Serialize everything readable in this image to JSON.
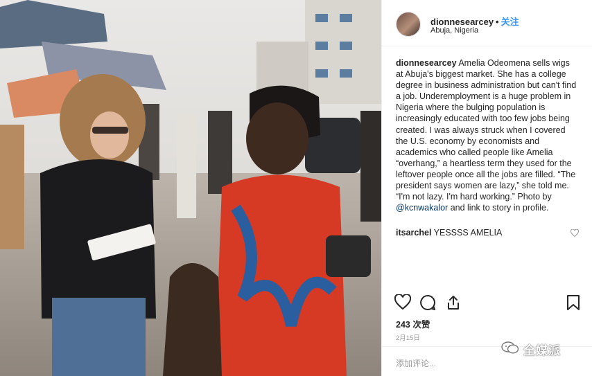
{
  "post": {
    "image_alt": "market scene",
    "header": {
      "username": "dionnesearcey",
      "dot": "•",
      "follow_label": "关注",
      "location": "Abuja, Nigeria"
    },
    "caption": {
      "username": "dionnesearcey",
      "text_part1": "Amelia Odeomena sells wigs at Abuja's biggest market. She has a college degree in business administration but can't find a job. Underemployment is a huge problem in Nigeria where the bulging population is increasingly educated with too few jobs being created. I was always struck when I covered the U.S. economy by economists and academics who called people like Amelia “overhang,” a heartless term they used for the leftover people once all the jobs are filled. “The president says women are lazy,” she told me. “I'm not lazy. I'm hard working.” Photo by",
      "mention": "@kcnwakalor",
      "text_part2": "and link to story in profile."
    },
    "comments": [
      {
        "username": "itsarchel",
        "text": "YESSSS AMELIA"
      }
    ],
    "likes": "243 次赞",
    "date": "2月15日",
    "add_comment_placeholder": "添加评论..."
  },
  "watermark": {
    "text": "全媒派",
    "icon": "wechat-icon"
  },
  "icons": {
    "like": "heart-outline-icon",
    "comment": "speech-bubble-icon",
    "share": "share-icon",
    "save": "bookmark-icon",
    "comment_like": "heart-small-icon"
  },
  "colors": {
    "text": "#262626",
    "follow": "#3897f0",
    "muted": "#999999",
    "mention": "#003569",
    "border": "#efefef"
  }
}
